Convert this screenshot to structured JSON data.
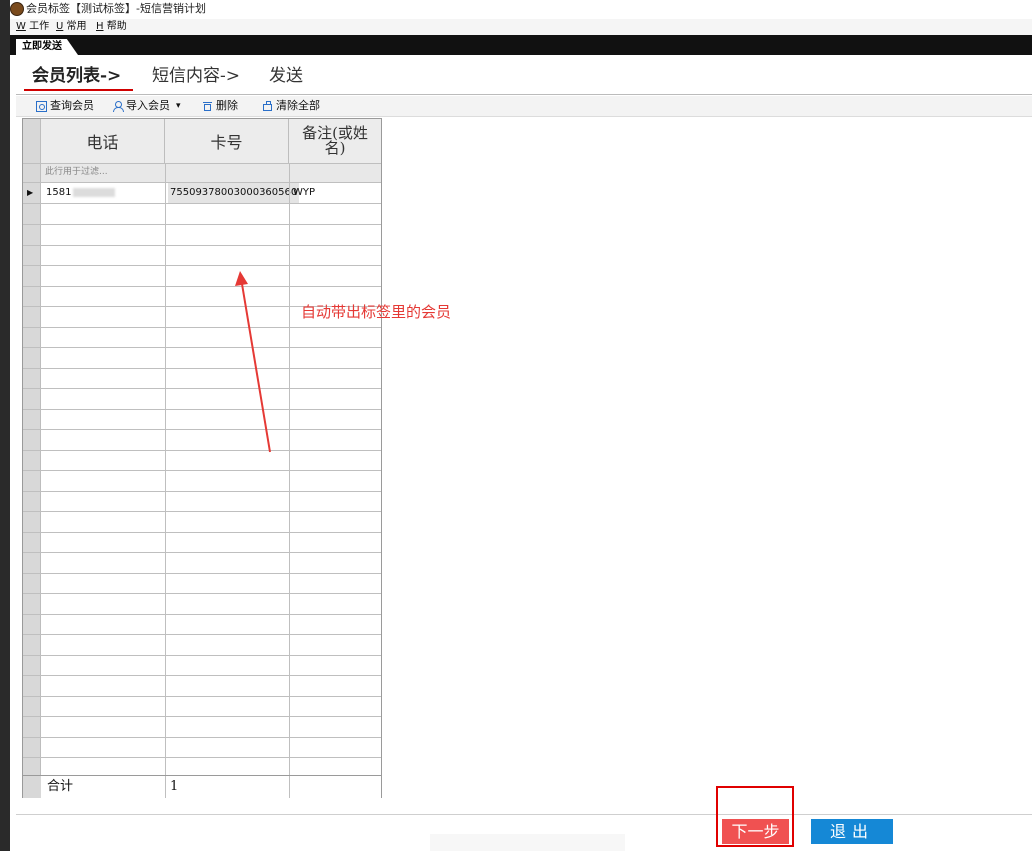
{
  "window": {
    "title": "会员标签【测试标签】-短信营销计划"
  },
  "menu": [
    {
      "key": "W",
      "label": "工作"
    },
    {
      "key": "U",
      "label": "常用"
    },
    {
      "key": "H",
      "label": "帮助"
    }
  ],
  "doc_tab": "立即发送",
  "steps": [
    "会员列表->",
    "短信内容->",
    "发送"
  ],
  "toolbar": {
    "query_label": "查询会员",
    "import_label": "导入会员",
    "dropdown_glyph": "▾",
    "delete_label": "删除",
    "clear_label": "清除全部"
  },
  "grid": {
    "columns": [
      "电话",
      "卡号",
      "备注(或姓名)"
    ],
    "filter_placeholder": "此行用于过滤...",
    "rows": [
      {
        "phone": "1581",
        "card": "75509378003000360560",
        "note": "WYP"
      }
    ],
    "footer_label": "合计",
    "footer_count": "1"
  },
  "annotation": {
    "text": "自动带出标签里的会员",
    "color": "#e53935"
  },
  "buttons": {
    "next": "下一步",
    "exit": "退出"
  },
  "colors": {
    "next_button": "#f05151",
    "exit_button": "#1588d6",
    "accent_red": "#d00000"
  },
  "icons": [
    "app-icon",
    "search-icon",
    "user-import-icon",
    "trash-icon",
    "clear-all-icon",
    "row-pointer-icon"
  ]
}
